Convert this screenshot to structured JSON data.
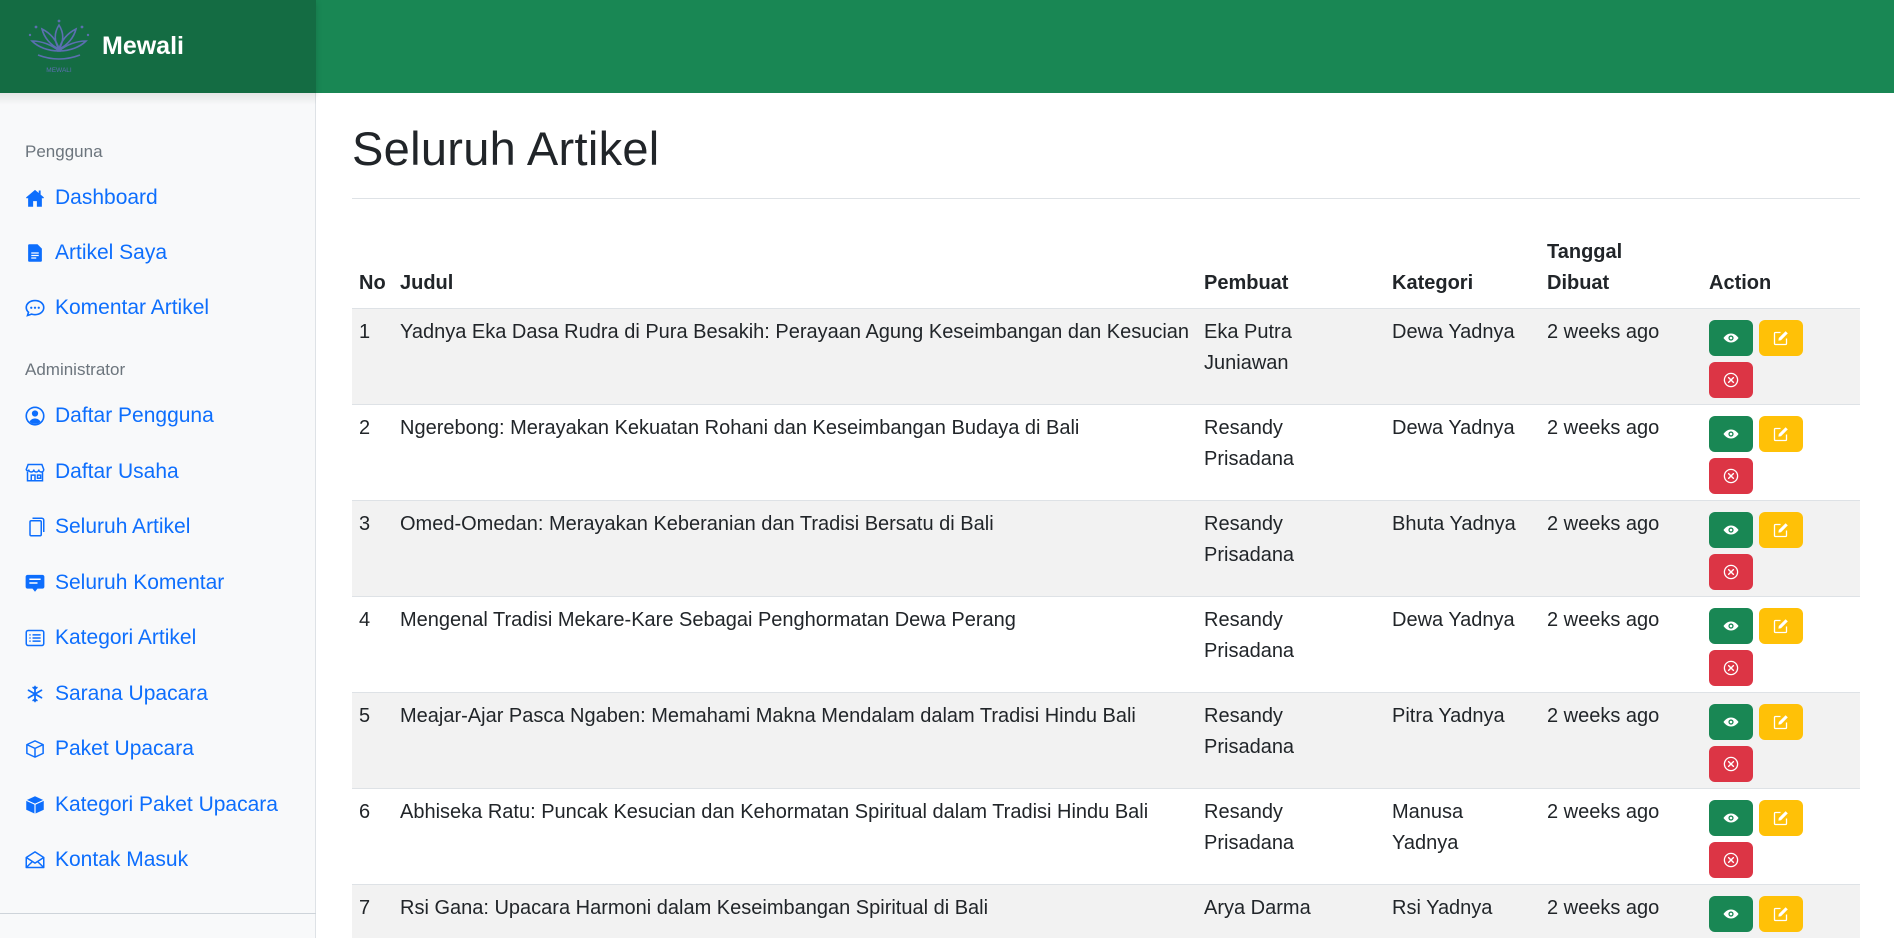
{
  "brand": {
    "name": "Mewali",
    "logo_text": "MEWALI"
  },
  "sidebar": {
    "sections": [
      {
        "heading": "Pengguna",
        "items": [
          {
            "label": "Dashboard",
            "icon": "house-icon"
          },
          {
            "label": "Artikel Saya",
            "icon": "file-icon"
          },
          {
            "label": "Komentar Artikel",
            "icon": "chat-icon"
          }
        ]
      },
      {
        "heading": "Administrator",
        "items": [
          {
            "label": "Daftar Pengguna",
            "icon": "person-circle-icon"
          },
          {
            "label": "Daftar Usaha",
            "icon": "shop-icon"
          },
          {
            "label": "Seluruh Artikel",
            "icon": "files-icon"
          },
          {
            "label": "Seluruh Komentar",
            "icon": "chat-square-icon"
          },
          {
            "label": "Kategori Artikel",
            "icon": "list-icon"
          },
          {
            "label": "Sarana Upacara",
            "icon": "snowflake-icon"
          },
          {
            "label": "Paket Upacara",
            "icon": "box-icon"
          },
          {
            "label": "Kategori Paket Upacara",
            "icon": "box-fill-icon"
          },
          {
            "label": "Kontak Masuk",
            "icon": "envelope-icon"
          }
        ]
      }
    ]
  },
  "main": {
    "title": "Seluruh Artikel",
    "table": {
      "headers": {
        "no": "No",
        "judul": "Judul",
        "pembuat": "Pembuat",
        "kategori": "Kategori",
        "tanggal_1": "Tanggal",
        "tanggal_2": "Dibuat",
        "action": "Action"
      },
      "rows": [
        {
          "no": "1",
          "judul": "Yadnya Eka Dasa Rudra di Pura Besakih: Perayaan Agung Keseimbangan dan Kesucian",
          "pembuat": "Eka Putra Juniawan",
          "kategori": "Dewa Yadnya",
          "tanggal": "2 weeks ago"
        },
        {
          "no": "2",
          "judul": "Ngerebong: Merayakan Kekuatan Rohani dan Keseimbangan Budaya di Bali",
          "pembuat": "Resandy Prisadana",
          "kategori": "Dewa Yadnya",
          "tanggal": "2 weeks ago"
        },
        {
          "no": "3",
          "judul": "Omed-Omedan: Merayakan Keberanian dan Tradisi Bersatu di Bali",
          "pembuat": "Resandy Prisadana",
          "kategori": "Bhuta Yadnya",
          "tanggal": "2 weeks ago"
        },
        {
          "no": "4",
          "judul": "Mengenal Tradisi Mekare-Kare Sebagai Penghormatan Dewa Perang",
          "pembuat": "Resandy Prisadana",
          "kategori": "Dewa Yadnya",
          "tanggal": "2 weeks ago"
        },
        {
          "no": "5",
          "judul": "Meajar-Ajar Pasca Ngaben: Memahami Makna Mendalam dalam Tradisi Hindu Bali",
          "pembuat": "Resandy Prisadana",
          "kategori": "Pitra Yadnya",
          "tanggal": "2 weeks ago"
        },
        {
          "no": "6",
          "judul": "Abhiseka Ratu: Puncak Kesucian dan Kehormatan Spiritual dalam Tradisi Hindu Bali",
          "pembuat": "Resandy Prisadana",
          "kategori": "Manusa Yadnya",
          "tanggal": "2 weeks ago"
        },
        {
          "no": "7",
          "judul": "Rsi Gana: Upacara Harmoni dalam Keseimbangan Spiritual di Bali",
          "pembuat": "Arya Darma",
          "kategori": "Rsi Yadnya",
          "tanggal": "2 weeks ago"
        }
      ]
    }
  },
  "colors": {
    "header_green": "#198754",
    "brand_green": "#146c43",
    "link_blue": "#0d6efd",
    "view_button": "#198754",
    "edit_button": "#ffc107",
    "delete_button": "#dc3545"
  }
}
